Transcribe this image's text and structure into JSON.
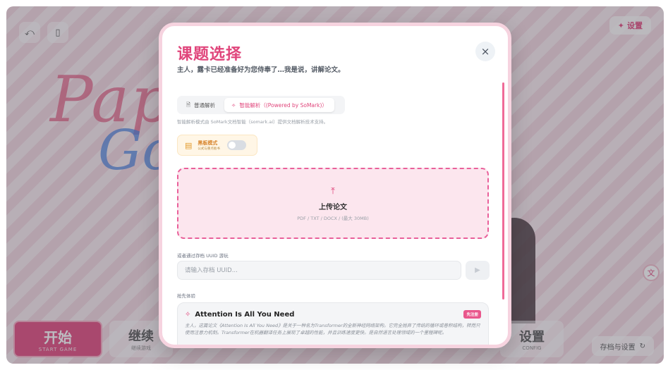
{
  "background": {
    "logo_line1": "Pap",
    "logo_line2": "Go",
    "top_right_label": "设置",
    "start": {
      "label": "开始",
      "sub": "START GAME"
    },
    "menu": [
      {
        "label": "继续",
        "sub": "继续游戏"
      },
      {
        "label": "设置",
        "sub": "CONFIG"
      }
    ],
    "bottom_right_label": "存档与设置"
  },
  "modal": {
    "title": "课题选择",
    "subtitle": "主人，露卡已经准备好为您侍奉了…我是说，讲解论文。",
    "close_icon": "×",
    "tabs": [
      {
        "label": "普通解析",
        "icon": "document-icon"
      },
      {
        "label": "智能解析（(Powered by SoMark)）",
        "icon": "sparkle-icon"
      }
    ],
    "mode_desc": "智能解析模式由 SoMark文档智能（somark.ai）提供文档解析技术支持。",
    "blackboard": {
      "title": "黑板模式",
      "sub": "公式与重点板书"
    },
    "upload": {
      "title": "上传论文",
      "formats": "PDF / TXT / DOCX / (最大 30MB)"
    },
    "uuid": {
      "label": "或者通过存档 UUID 游玩",
      "placeholder": "请输入存档 UUID..."
    },
    "quick_label": "抢先体验",
    "paper": {
      "title": "Attention Is All You Need",
      "badge": "先注册",
      "description": "主人，这篇论文《Attention Is All You Need》是关于一种名为Transformer的全新神经网络架构。它完全抛弃了传统的循环或卷积结构，转而只使用注意力机制。Transformer在机器翻译任务上展现了卓越的性能，并且训练速度更快。是自然语言处理领域的一个里程碑呢。"
    }
  },
  "colors": {
    "accent": "#e0457b",
    "upload_border": "#e9609a",
    "upload_bg": "#fce6ee"
  }
}
